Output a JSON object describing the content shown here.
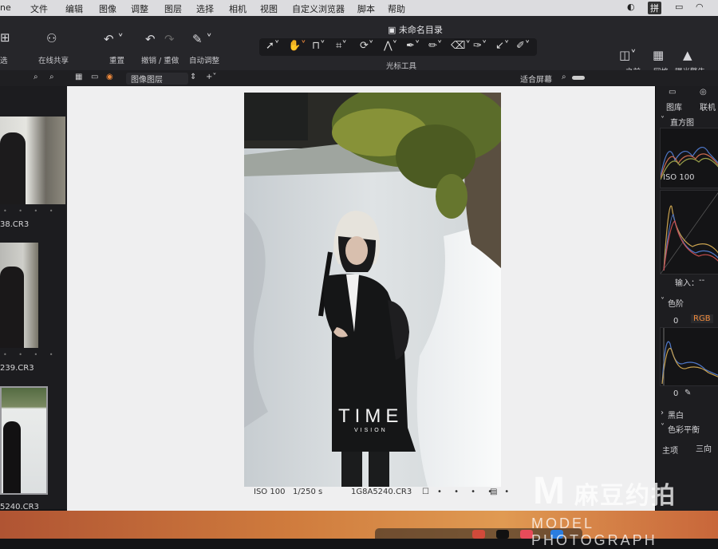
{
  "menubar": {
    "app": "ne",
    "items": [
      "文件",
      "编辑",
      "图像",
      "调整",
      "图层",
      "选择",
      "相机",
      "视图",
      "自定义浏览器",
      "脚本",
      "帮助"
    ],
    "input_method": "拼"
  },
  "toolbar": {
    "doc_title": "未命名目录",
    "left_cut": "选",
    "share": "在线共享",
    "reset": "重置",
    "undo_redo": "撤销 / 重做",
    "auto_adjust": "自动调整",
    "cursor_tools": "光标工具",
    "before": "之前",
    "grid": "网格",
    "exposure_warning": "曝光警告"
  },
  "subbar": {
    "layer_select": "图像图层",
    "fit_screen": "适合屏幕"
  },
  "browser": {
    "files": [
      "38.CR3",
      "239.CR3",
      "5240.CR3"
    ]
  },
  "viewer": {
    "watermark_main": "TIME",
    "watermark_sub": "VISION",
    "iso": "ISO 100",
    "shutter": "1/250 s",
    "filename": "1G8A5240.CR3"
  },
  "inspector": {
    "tabs": [
      "图库",
      "联机"
    ],
    "histogram": "直方图",
    "hist_iso": "ISO 100",
    "input_label": "输入：",
    "input_value": "--",
    "levels": "色阶",
    "levels_low": "0",
    "levels_channel": "RGB",
    "levels_out": "0",
    "bw": "黑白",
    "color_balance": "色彩平衡",
    "cb_master": "主项",
    "cb_three": "三向"
  },
  "overlay": {
    "brand_cn": "麻豆约拍",
    "brand_en": "MODEL PHOTOGRAPH",
    "brand_letter": "M"
  }
}
